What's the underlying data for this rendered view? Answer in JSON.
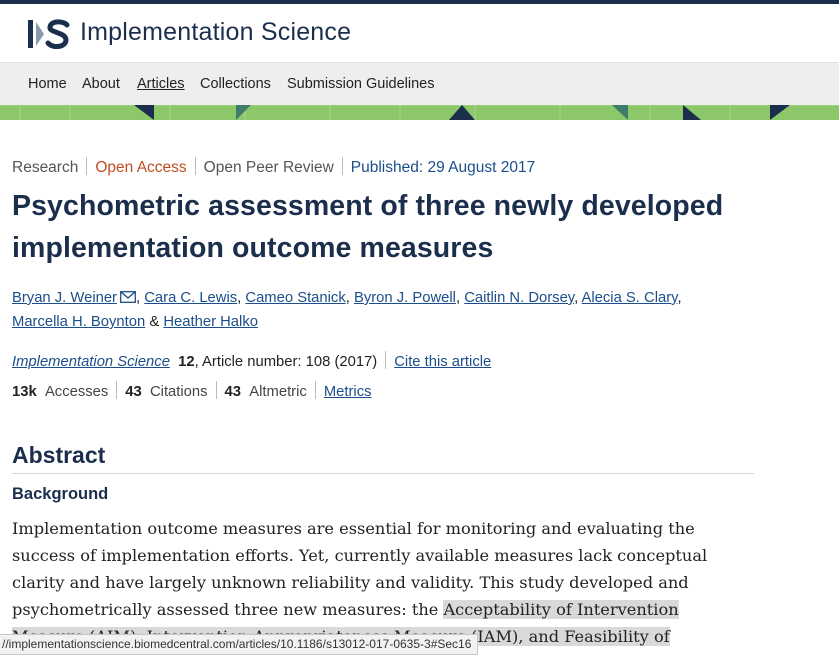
{
  "site": {
    "title": "Implementation Science"
  },
  "nav": [
    {
      "label": "Home",
      "active": false
    },
    {
      "label": "About",
      "active": false
    },
    {
      "label": "Articles",
      "active": true
    },
    {
      "label": "Collections",
      "active": false
    },
    {
      "label": "Submission Guidelines",
      "active": false
    }
  ],
  "article": {
    "type": "Research",
    "access": "Open Access",
    "review": "Open Peer Review",
    "published": "Published: 29 August 2017",
    "title": "Psychometric assessment of three newly developed implementation outcome measures",
    "authors": [
      "Bryan J. Weiner",
      "Cara C. Lewis",
      "Cameo Stanick",
      "Byron J. Powell",
      "Caitlin N. Dorsey",
      "Alecia S. Clary",
      "Marcella H. Boynton",
      "Heather Halko"
    ],
    "author_joiner": "&",
    "journal": "Implementation Science",
    "volume": "12",
    "article_number": ", Article number: 108 (2017)",
    "cite_label": "Cite this article",
    "metrics": {
      "accesses_value": "13k",
      "accesses_label": "Accesses",
      "citations_value": "43",
      "citations_label": "Citations",
      "altmetric_value": "43",
      "altmetric_label": "Altmetric",
      "metrics_link": "Metrics"
    }
  },
  "abstract": {
    "heading": "Abstract",
    "subheading": "Background",
    "text_plain": "Implementation outcome measures are essential for monitoring and evaluating the success of implementation efforts. Yet, currently available measures lack conceptual clarity and have largely unknown reliability and validity. This study developed and psychometrically assessed three new measures: the ",
    "text_highlighted": "Acceptability of Intervention Measure (AIM), Intervention Appropriateness Measure (IAM), and Feasibility of"
  },
  "status_url": "//implementationscience.biomedcentral.com/articles/10.1186/s13012-017-0635-3#Sec16",
  "colors": {
    "brand_navy": "#1b2f4d",
    "link_blue": "#1b4e8b",
    "open_access_orange": "#c24d21",
    "band_green": "#8cc76a"
  },
  "icons": {
    "logo": "is-logo",
    "email": "envelope-icon"
  }
}
